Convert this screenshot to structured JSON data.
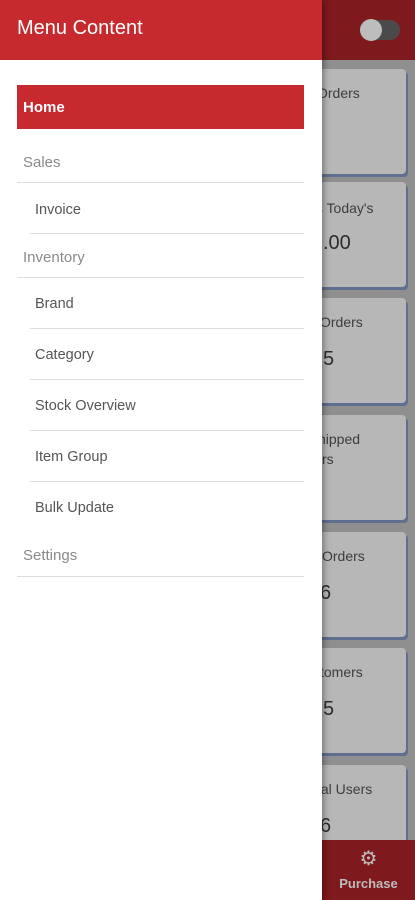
{
  "drawer": {
    "title": "Menu Content",
    "home": "Home",
    "sales": {
      "label": "Sales",
      "items": [
        "Invoice"
      ]
    },
    "inventory": {
      "label": "Inventory",
      "items": [
        "Brand",
        "Category",
        "Stock Overview",
        "Item Group",
        "Bulk Update"
      ]
    },
    "settings": "Settings"
  },
  "background": {
    "cards": [
      {
        "title": "Orders",
        "value": ""
      },
      {
        "title": "ts Today's",
        "value": ".00"
      },
      {
        "title": "Orders",
        "value": "5"
      },
      {
        "title": "hipped",
        "title2": "rs",
        "value": ""
      },
      {
        "title": "Orders",
        "value": "6"
      },
      {
        "title": "tomers",
        "value": "5"
      },
      {
        "title": "tal Users",
        "value": "6"
      }
    ],
    "bottom_tab": {
      "label": "Purchase",
      "icon": "gear-icon"
    }
  },
  "colors": {
    "accent": "#c62a2f"
  }
}
